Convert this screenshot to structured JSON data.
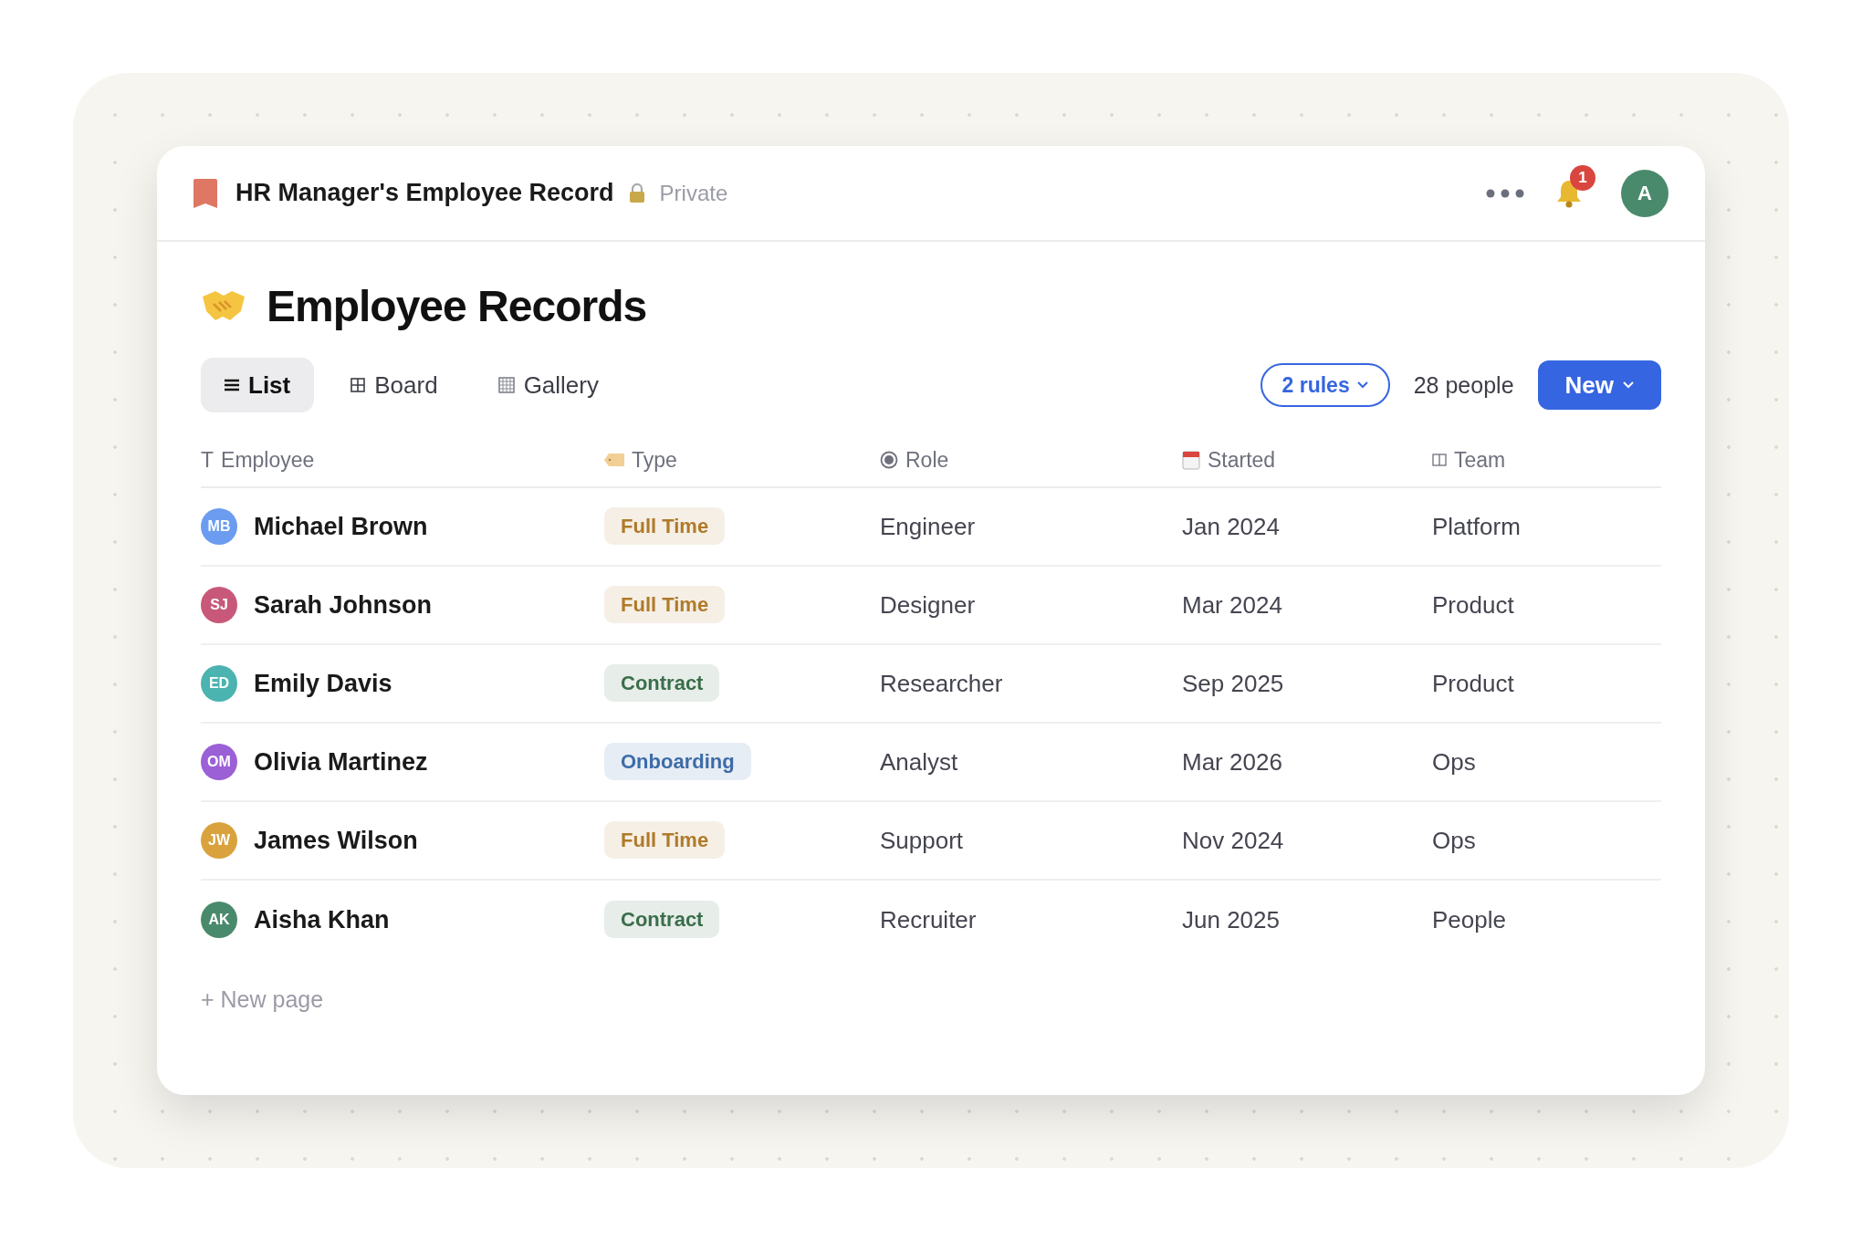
{
  "header": {
    "title": "HR Manager's Employee Record",
    "privacy": "Private",
    "notifications": "1",
    "avatar": "A"
  },
  "page": {
    "title": "Employee Records"
  },
  "views": [
    {
      "label": "List",
      "selected": true
    },
    {
      "label": "Board",
      "selected": false
    },
    {
      "label": "Gallery",
      "selected": false
    }
  ],
  "toolbar": {
    "filter": "2 rules",
    "count": "28 people",
    "new_button": "New"
  },
  "table": {
    "columns": [
      {
        "label": "Employee",
        "glyph": "T"
      },
      {
        "label": "Type"
      },
      {
        "label": "Role"
      },
      {
        "label": "Started"
      },
      {
        "label": "Team"
      }
    ],
    "rows": [
      {
        "avatar": {
          "initials": "MB",
          "color": "#6b9cf0"
        },
        "name": "Michael Brown",
        "type": {
          "label": "Full Time",
          "color": "#b07a2a"
        },
        "role": "Engineer",
        "started": "Jan 2024",
        "team": "Platform"
      },
      {
        "avatar": {
          "initials": "SJ",
          "color": "#c8587a"
        },
        "name": "Sarah Johnson",
        "type": {
          "label": "Full Time",
          "color": "#b07a2a"
        },
        "role": "Designer",
        "started": "Mar 2024",
        "team": "Product"
      },
      {
        "avatar": {
          "initials": "ED",
          "color": "#4bb3b0"
        },
        "name": "Emily Davis",
        "type": {
          "label": "Contract",
          "color": "#3a6e4a"
        },
        "role": "Researcher",
        "started": "Sep 2025",
        "team": "Product"
      },
      {
        "avatar": {
          "initials": "OM",
          "color": "#9b5fd6"
        },
        "name": "Olivia Martinez",
        "type": {
          "label": "Onboarding",
          "color": "#3c6ca8"
        },
        "role": "Analyst",
        "started": "Mar 2026",
        "team": "Ops"
      },
      {
        "avatar": {
          "initials": "JW",
          "color": "#d9a23c"
        },
        "name": "James Wilson",
        "type": {
          "label": "Full Time",
          "color": "#b07a2a"
        },
        "role": "Support",
        "started": "Nov 2024",
        "team": "Ops"
      },
      {
        "avatar": {
          "initials": "AK",
          "color": "#4a8a6c"
        },
        "name": "Aisha Khan",
        "type": {
          "label": "Contract",
          "color": "#3a6e4a"
        },
        "role": "Recruiter",
        "started": "Jun 2025",
        "team": "People"
      }
    ],
    "add_row": "+ New page"
  }
}
